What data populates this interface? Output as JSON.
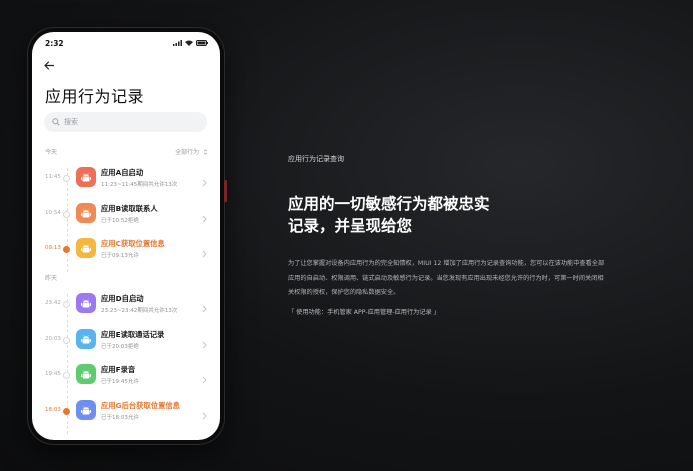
{
  "status_bar": {
    "time": "2:32"
  },
  "page": {
    "title": "应用行为记录",
    "search_placeholder": "搜索",
    "filter_label": "全部行为"
  },
  "sections": [
    {
      "label": "今天",
      "items": [
        {
          "time": "11:45",
          "name": "应用A自启动",
          "desc": "11:23~11:45期间共允许13次",
          "highlight": false,
          "icon_color": "#ee6f55"
        },
        {
          "time": "10:54",
          "name": "应用B读取联系人",
          "desc": "已于10:52拒绝",
          "highlight": false,
          "icon_color": "#ef8a55"
        },
        {
          "time": "09:13",
          "name": "应用C获取位置信息",
          "desc": "已于09:13允许",
          "highlight": true,
          "icon_color": "#f4b73b"
        }
      ]
    },
    {
      "label": "昨天",
      "items": [
        {
          "time": "23:42",
          "name": "应用D自启动",
          "desc": "23:23~23:42期间共允许13次",
          "highlight": false,
          "icon_color": "#9c79f0"
        },
        {
          "time": "20:03",
          "name": "应用E读取通话记录",
          "desc": "已于20:03拒绝",
          "highlight": false,
          "icon_color": "#58b3f0"
        },
        {
          "time": "19:45",
          "name": "应用F录音",
          "desc": "已于19:45允许",
          "highlight": false,
          "icon_color": "#5ccc6c"
        },
        {
          "time": "18:03",
          "name": "应用G后台获取位置信息",
          "desc": "已于18:03允许",
          "highlight": true,
          "icon_color": "#6f8ff0"
        }
      ]
    }
  ],
  "promo": {
    "label": "应用行为记录查询",
    "headline_line1": "应用的一切敏感行为都被忠实",
    "headline_line2": "记录，并呈现给您",
    "para_line1": "为了让您掌握对设备内应用行为的完全知情权，MIUI 12 增加了应用行为记录查询功能，您可以在该功能中查看全部",
    "para_line2": "应用的自启动、权限调用、链式启动及敏感行为记录。当您发现有应用出现未经您允许的行为时，可第一时间关闭相",
    "para_line3": "关权限的授权，保护您的隐私数据安全。",
    "usage": "「   使用功能：手机管家 APP-应用管理-应用行为记录   」"
  }
}
